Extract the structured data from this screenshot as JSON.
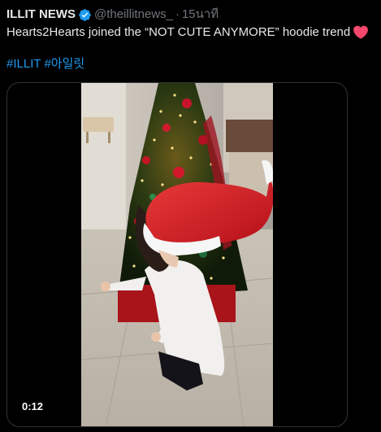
{
  "author": {
    "display_name": "ILLIT NEWS",
    "handle": "@theillitnews_",
    "separator": "·",
    "timestamp": "15นาที",
    "verified_icon": "verified-badge-icon",
    "verified_color": "#1d9bf0"
  },
  "tweet": {
    "text": "Hearts2Hearts joined the “NOT CUTE ANYMORE” hoodie trend",
    "emoji": "heart-icon",
    "emoji_color": "#f4476b",
    "hashtags": [
      "#ILLIT",
      "#아일릿"
    ],
    "hashtag_color": "#1d9bf0"
  },
  "media": {
    "type": "video",
    "duration": "0:12"
  }
}
